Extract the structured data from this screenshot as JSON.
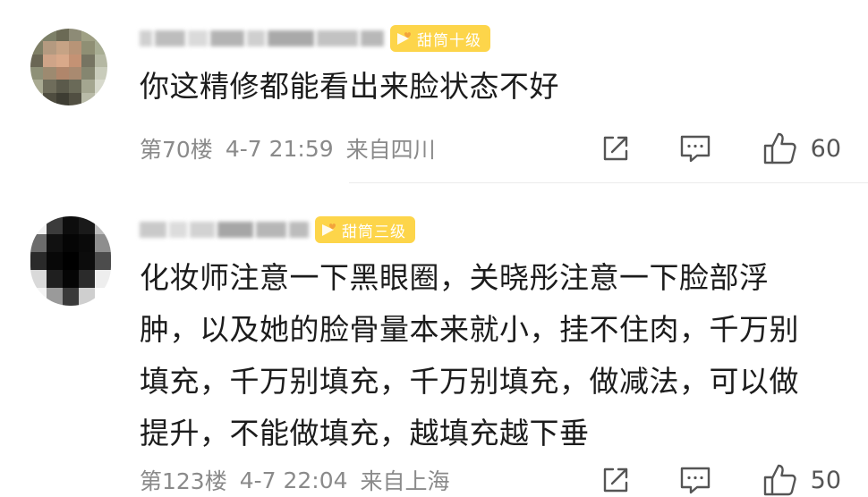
{
  "comments": [
    {
      "badge": "甜筒十级",
      "text_lines": [
        "你这精修都能看出来脸状态不好"
      ],
      "floor": "第70楼",
      "time": "4-7 21:59",
      "location": "来自四川",
      "likes": "60"
    },
    {
      "badge": "甜筒三级",
      "text_lines": [
        "化妆师注意一下黑眼圈，关晓彤注意一下脸部浮",
        "肿，以及她的脸骨量本来就小，挂不住肉，千万别",
        "填充，千万别填充，千万别填充，做减法，可以做",
        "提升，不能做填充，越填充越下垂"
      ],
      "floor": "第123楼",
      "time": "4-7 22:04",
      "location": "来自上海",
      "likes": "50"
    }
  ],
  "icons": {
    "avatar": "pixelated-avatar",
    "badge": "heart-cone-icon",
    "share": "share-icon",
    "reply": "comment-icon",
    "like": "thumbs-up-icon"
  },
  "colors": {
    "badge_bg": "#fdd54a",
    "text": "#1c1c1c",
    "meta": "#8a8a8a",
    "icon": "#555555"
  }
}
